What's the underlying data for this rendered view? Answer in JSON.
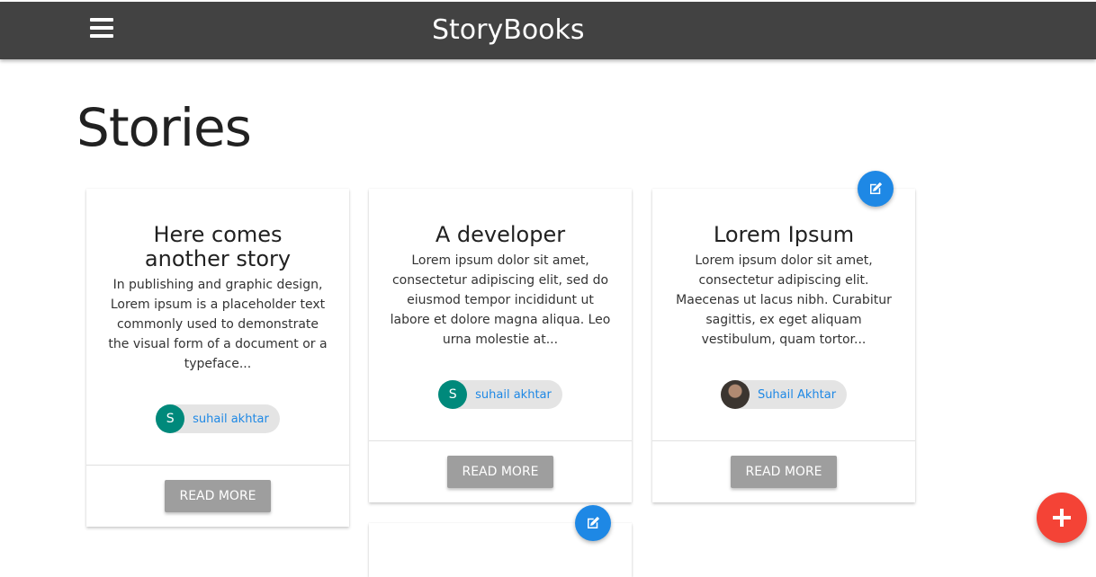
{
  "navbar": {
    "brand": "StoryBooks",
    "menu_icon": "hamburger-menu-icon",
    "background": "#424242"
  },
  "page": {
    "title": "Stories"
  },
  "stories": [
    {
      "title": "Here comes another story",
      "excerpt": "In publishing and graphic design, Lorem ipsum is a placeholder text commonly used to demonstrate the visual form of a document or a typeface...",
      "author": "suhail akhtar",
      "avatar_letter": "S",
      "read_more": "READ MORE"
    },
    {
      "title": "A developer",
      "excerpt": "Lorem ipsum dolor sit amet, consectetur adipiscing elit, sed do eiusmod tempor incididunt ut labore et dolore magna aliqua. Leo urna molestie at...",
      "author": "suhail akhtar",
      "avatar_letter": "S",
      "read_more": "READ MORE"
    },
    {
      "title": "Lorem Ipsum",
      "excerpt": "Lorem ipsum dolor sit amet, consectetur adipiscing elit. Maecenas ut lacus nibh. Curabitur sagittis, ex eget aliquam vestibulum, quam tortor...",
      "author": "Suhail Akhtar",
      "avatar_icon": "user-photo-avatar",
      "read_more": "READ MORE"
    }
  ],
  "colors": {
    "accent_blue": "#1e88e5",
    "fab_red": "#f44336",
    "avatar_teal": "#00897b",
    "button_grey": "#9e9e9e"
  },
  "icons": {
    "edit": "edit-icon",
    "add": "add-icon"
  }
}
